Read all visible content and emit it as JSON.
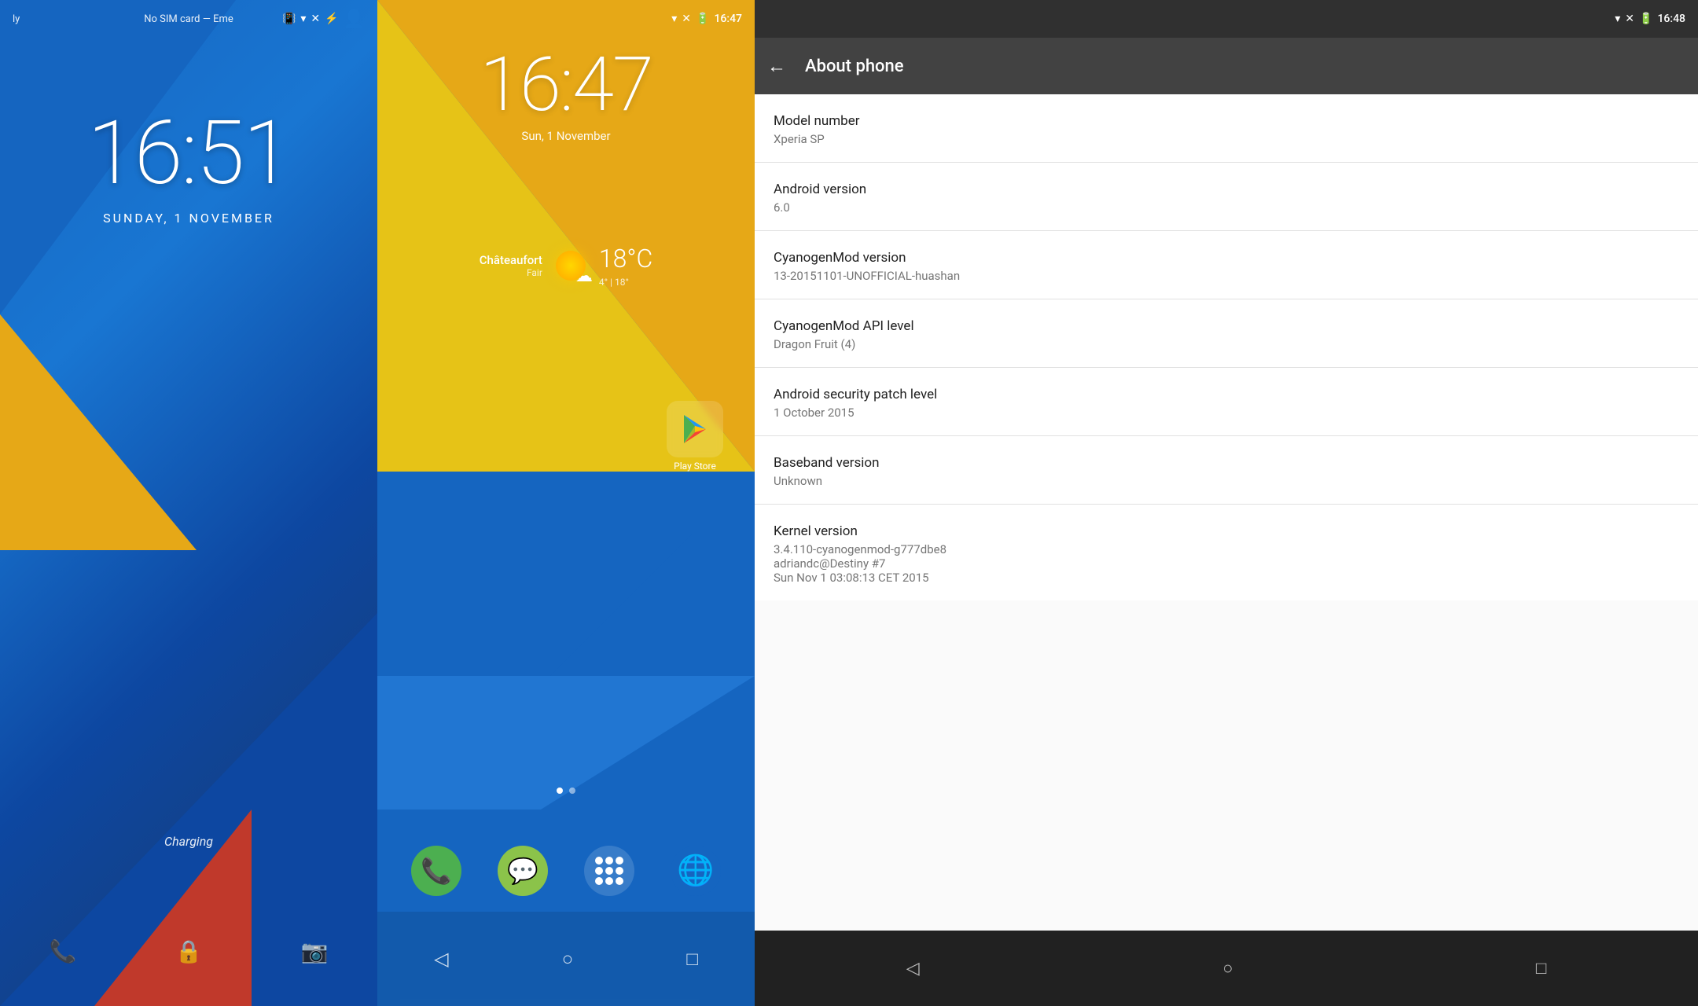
{
  "lock_screen": {
    "status_left": "ly",
    "status_center": "No SIM card — Eme",
    "time": "16:51",
    "date": "SUNDAY, 1 NOVEMBER",
    "charging_text": "Charging",
    "status_icons": [
      "vibrate",
      "wifi",
      "network",
      "battery"
    ],
    "bottom_icons": [
      "phone",
      "lock",
      "camera"
    ]
  },
  "home_screen": {
    "status_time": "16:47",
    "clock": "16:47",
    "date": "Sun, 1 November",
    "weather": {
      "location": "Châteaufort",
      "condition": "Fair",
      "temp": "18°C",
      "low": "4°",
      "high": "18°"
    },
    "play_store_label": "Play Store",
    "dock_icons": [
      "Phone",
      "Messenger",
      "Apps",
      "Browser"
    ],
    "dots": [
      true,
      false
    ],
    "nav_icons": [
      "back",
      "home",
      "recent"
    ]
  },
  "about_phone": {
    "title": "About phone",
    "status_time": "16:48",
    "back_label": "←",
    "rows": [
      {
        "label": "Model number",
        "value": "Xperia SP"
      },
      {
        "label": "Android version",
        "value": "6.0"
      },
      {
        "label": "CyanogenMod version",
        "value": "13-20151101-UNOFFICIAL-huashan"
      },
      {
        "label": "CyanogenMod API level",
        "value": "Dragon Fruit (4)"
      },
      {
        "label": "Android security patch level",
        "value": "1 October 2015"
      },
      {
        "label": "Baseband version",
        "value": "Unknown"
      },
      {
        "label": "Kernel version",
        "value": "3.4.110-cyanogenmod-g777dbe8\nadriandc@Destiny #7\nSun Nov 1 03:08:13 CET 2015"
      }
    ],
    "nav_icons": [
      "back",
      "home",
      "recent"
    ]
  }
}
